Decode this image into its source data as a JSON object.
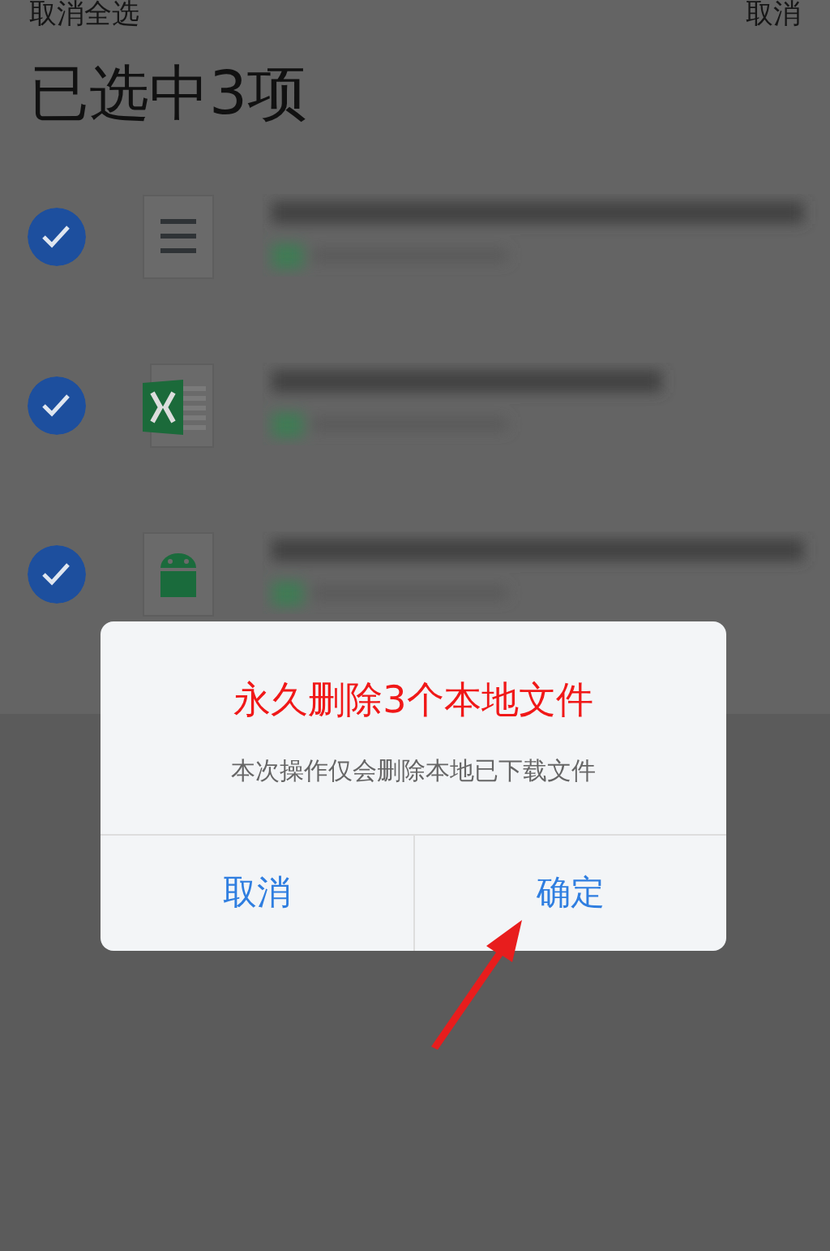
{
  "header": {
    "left_action": "取消全选",
    "right_action": "取消",
    "title": "已选中3项"
  },
  "files": [
    {
      "kind": "doc",
      "checked": true
    },
    {
      "kind": "excel",
      "checked": true
    },
    {
      "kind": "apk",
      "checked": true
    }
  ],
  "dialog": {
    "title": "永久删除3个本地文件",
    "message": "本次操作仅会删除本地已下载文件",
    "buttons": [
      "取消",
      "确定"
    ]
  }
}
